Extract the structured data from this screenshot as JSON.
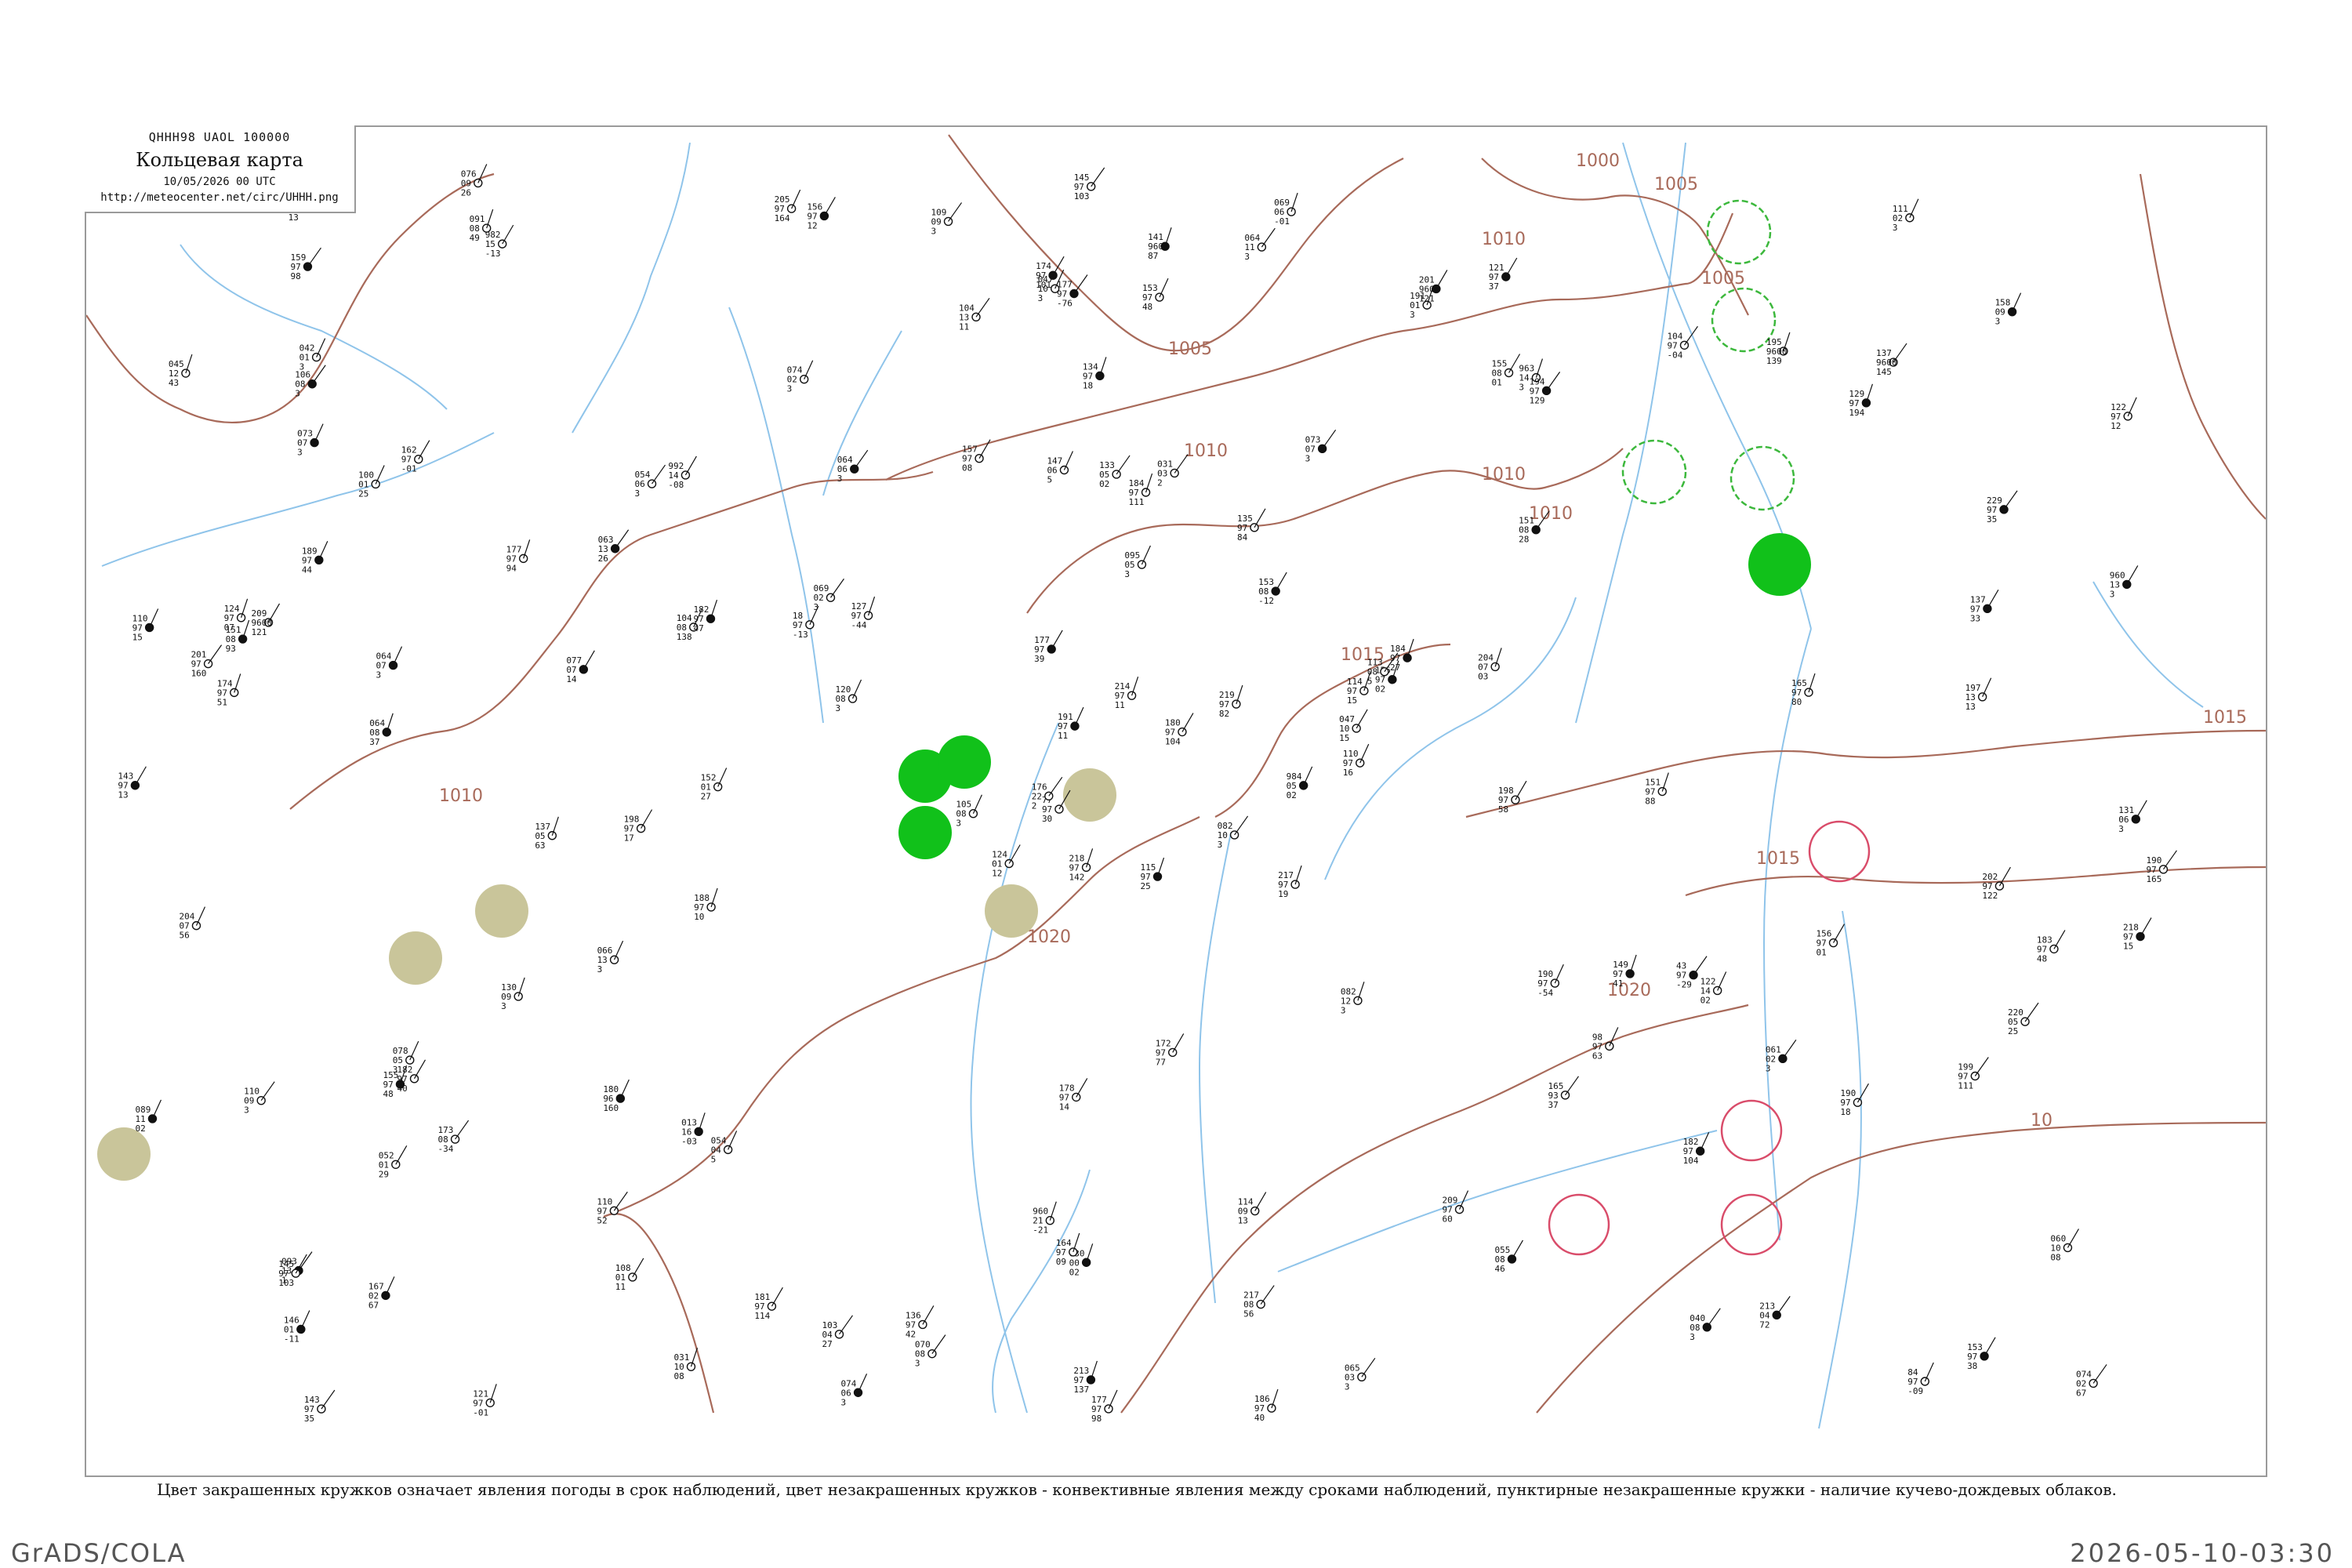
{
  "header": {
    "code_line": "QHHH98  UAOL  100000",
    "title": "Кольцевая карта",
    "date": "10/05/2026 00 UTC",
    "url": "http://meteocenter.net/circ/UHHH.png"
  },
  "caption": "Цвет закрашенных кружков означает явления погоды в срок наблюдений, цвет незакрашенных кружков - конвективные явления между сроками наблюдений, пунктирные незакрашенные кружки - наличие кучево-дождевых облаков.",
  "footer": {
    "left": "GrADS/COLA",
    "right": "2026-05-10-03:30"
  },
  "colors": {
    "isobar": "#a86a5a",
    "river": "#8fc4ea",
    "fill_green": "#11c11a",
    "fill_olive": "#c9c59a",
    "ring_green": "#3cb83c",
    "ring_red": "#d94c6a",
    "station": "#111111"
  },
  "isobar_labels": [
    "1000",
    "1005",
    "1005",
    "1005",
    "1010",
    "1010",
    "1010",
    "1010",
    "1010",
    "1015",
    "1015",
    "1015",
    "1020",
    "1020",
    "10"
  ],
  "stations": [
    {
      "t": "115",
      "d": "97",
      "p": "25"
    },
    {
      "t": "100",
      "d": "01",
      "p": "25"
    },
    {
      "t": "77",
      "d": "97",
      "p": "30"
    },
    {
      "t": "093",
      "d": "13",
      "p": "1"
    },
    {
      "t": "114",
      "d": "97",
      "p": "15"
    },
    {
      "t": "054",
      "d": "04",
      "p": "5"
    },
    {
      "t": "121",
      "d": "97",
      "p": "37"
    },
    {
      "t": "031",
      "d": "03",
      "p": "2"
    },
    {
      "t": "963",
      "d": "14",
      "p": "3"
    },
    {
      "t": "984",
      "d": "05",
      "p": "02"
    },
    {
      "t": "982",
      "d": "15",
      "p": "-13"
    },
    {
      "t": "074",
      "d": "02",
      "p": "67"
    },
    {
      "t": "064",
      "d": "08",
      "p": "37"
    },
    {
      "t": "122",
      "d": "97",
      "p": "12"
    },
    {
      "t": "124",
      "d": "01",
      "p": "12"
    },
    {
      "t": "151",
      "d": "08",
      "p": "28"
    },
    {
      "t": "121",
      "d": "97",
      "p": "-01"
    },
    {
      "t": "147",
      "d": "06",
      "p": "5"
    },
    {
      "t": "153",
      "d": "08",
      "p": "-12"
    },
    {
      "t": "173",
      "d": "08",
      "p": "-34"
    },
    {
      "t": "127",
      "d": "97",
      "p": "-44"
    },
    {
      "t": "146",
      "d": "01",
      "p": "-11"
    },
    {
      "t": "108",
      "d": "01",
      "p": "11"
    },
    {
      "t": "133",
      "d": "05",
      "p": "02"
    },
    {
      "t": "156",
      "d": "97",
      "p": "02"
    },
    {
      "t": "122",
      "d": "14",
      "p": "02"
    },
    {
      "t": "162",
      "d": "97",
      "p": "-01"
    },
    {
      "t": "177",
      "d": "97",
      "p": "-76"
    },
    {
      "t": "174",
      "d": "97",
      "p": "51"
    },
    {
      "t": "190",
      "d": "97",
      "p": "-54"
    },
    {
      "t": "960",
      "d": "13",
      "p": "3"
    },
    {
      "t": "176",
      "d": "22",
      "p": "2"
    },
    {
      "t": "960",
      "d": "21",
      "p": "-21"
    },
    {
      "t": "191",
      "d": "97",
      "p": "11"
    },
    {
      "t": "992",
      "d": "14",
      "p": "-08"
    },
    {
      "t": "104",
      "d": "97",
      "p": "-04"
    },
    {
      "t": "013",
      "d": "16",
      "p": "-03"
    },
    {
      "t": "84",
      "d": "97",
      "p": "-09"
    },
    {
      "t": "060",
      "d": "10",
      "p": "08"
    },
    {
      "t": "43",
      "d": "97",
      "p": "-29"
    },
    {
      "t": "069",
      "d": "06",
      "p": "-01"
    },
    {
      "t": "18",
      "d": "97",
      "p": "-13"
    },
    {
      "t": "077",
      "d": "07",
      "p": "14"
    },
    {
      "t": "165",
      "d": "93",
      "p": "37"
    },
    {
      "t": "031",
      "d": "10",
      "p": "08"
    },
    {
      "t": "110",
      "d": "97",
      "p": "15"
    },
    {
      "t": "047",
      "d": "10",
      "p": "15"
    },
    {
      "t": "143",
      "d": "97",
      "p": "35"
    },
    {
      "t": "030",
      "d": "00",
      "p": "02"
    },
    {
      "t": "110",
      "d": "97",
      "p": "16"
    },
    {
      "t": "052",
      "d": "01",
      "p": "29"
    },
    {
      "t": "229",
      "d": "97",
      "p": "35"
    },
    {
      "t": "045",
      "d": "12",
      "p": "43"
    },
    {
      "t": "98",
      "d": "97",
      "p": "63"
    },
    {
      "t": "055",
      "d": "08",
      "p": "46"
    },
    {
      "t": "110",
      "d": "97",
      "p": "52"
    },
    {
      "t": "091",
      "d": "08",
      "p": "49"
    },
    {
      "t": "116",
      "d": "97",
      "p": "13"
    },
    {
      "t": "114",
      "d": "09",
      "p": "13"
    },
    {
      "t": "137",
      "d": "9600",
      "p": "145"
    },
    {
      "t": "141",
      "d": "9600",
      "p": "87"
    },
    {
      "t": "152",
      "d": "01",
      "p": "27"
    },
    {
      "t": "209",
      "d": "9600",
      "p": "121"
    },
    {
      "t": "063",
      "d": "13",
      "p": "26"
    },
    {
      "t": "195",
      "d": "9600",
      "p": "139"
    },
    {
      "t": "076",
      "d": "09",
      "p": "26"
    },
    {
      "t": "201",
      "d": "9600",
      "p": "121"
    },
    {
      "t": "104",
      "d": "13",
      "p": "11"
    },
    {
      "t": "214",
      "d": "97",
      "p": "11"
    },
    {
      "t": "089",
      "d": "11",
      "p": "02"
    },
    {
      "t": "178",
      "d": "97",
      "p": "14"
    },
    {
      "t": "103",
      "d": "04",
      "p": "27"
    },
    {
      "t": "149",
      "d": "97",
      "p": "41"
    },
    {
      "t": "104",
      "d": "08",
      "p": "138"
    },
    {
      "t": "145",
      "d": "97",
      "p": "103"
    },
    {
      "t": "159",
      "d": "97",
      "p": "98"
    },
    {
      "t": "177",
      "d": "97",
      "p": "94"
    },
    {
      "t": "204",
      "d": "07",
      "p": "56"
    },
    {
      "t": "177",
      "d": "97",
      "p": "39"
    },
    {
      "t": "217",
      "d": "08",
      "p": "56"
    },
    {
      "t": "219",
      "d": "97",
      "p": "82"
    },
    {
      "t": "167",
      "d": "02",
      "p": "67"
    },
    {
      "t": "198",
      "d": "97",
      "p": "58"
    },
    {
      "t": "220",
      "d": "05",
      "p": "25"
    },
    {
      "t": "213",
      "d": "97",
      "p": "137"
    },
    {
      "t": "197",
      "d": "13",
      "p": "13"
    },
    {
      "t": "172",
      "d": "97",
      "p": "77"
    },
    {
      "t": "213",
      "d": "04",
      "p": "72"
    },
    {
      "t": "186",
      "d": "97",
      "p": "40"
    },
    {
      "t": "209",
      "d": "97",
      "p": "60"
    },
    {
      "t": "174",
      "d": "97",
      "p": "101"
    },
    {
      "t": "190",
      "d": "97",
      "p": "165"
    },
    {
      "t": "204",
      "d": "07",
      "p": "03"
    },
    {
      "t": "182",
      "d": "97",
      "p": "104"
    },
    {
      "t": "180",
      "d": "97",
      "p": "104"
    },
    {
      "t": "199",
      "d": "97",
      "p": "111"
    },
    {
      "t": "151",
      "d": "08",
      "p": "93"
    },
    {
      "t": "177",
      "d": "97",
      "p": "98"
    },
    {
      "t": "155",
      "d": "08",
      "p": "01"
    },
    {
      "t": "194",
      "d": "97",
      "p": "129"
    },
    {
      "t": "137",
      "d": "05",
      "p": "63"
    },
    {
      "t": "205",
      "d": "97",
      "p": "164"
    },
    {
      "t": "131",
      "d": "06",
      "p": "3"
    },
    {
      "t": "201",
      "d": "97",
      "p": "160"
    },
    {
      "t": "130",
      "d": "09",
      "p": "3"
    },
    {
      "t": "180",
      "d": "96",
      "p": "160"
    },
    {
      "t": "181",
      "d": "97",
      "p": "114"
    },
    {
      "t": "113",
      "d": "08",
      "p": "5"
    },
    {
      "t": "129",
      "d": "97",
      "p": "194"
    },
    {
      "t": "120",
      "d": "08",
      "p": "3"
    },
    {
      "t": "202",
      "d": "97",
      "p": "122"
    },
    {
      "t": "106",
      "d": "08",
      "p": "3"
    },
    {
      "t": "184",
      "d": "97",
      "p": "111"
    },
    {
      "t": "105",
      "d": "08",
      "p": "3"
    },
    {
      "t": "156",
      "d": "97",
      "p": "12"
    },
    {
      "t": "110",
      "d": "09",
      "p": "3"
    },
    {
      "t": "218",
      "d": "97",
      "p": "142"
    },
    {
      "t": "158",
      "d": "09",
      "p": "3"
    },
    {
      "t": "157",
      "d": "97",
      "p": "08"
    },
    {
      "t": "109",
      "d": "09",
      "p": "3"
    },
    {
      "t": "155",
      "d": "97",
      "p": "48"
    },
    {
      "t": "111",
      "d": "02",
      "p": "3"
    },
    {
      "t": "135",
      "d": "97",
      "p": "84"
    },
    {
      "t": "064",
      "d": "06",
      "p": "3"
    },
    {
      "t": "151",
      "d": "97",
      "p": "88"
    },
    {
      "t": "066",
      "d": "13",
      "p": "3"
    },
    {
      "t": "153",
      "d": "97",
      "p": "38"
    },
    {
      "t": "070",
      "d": "08",
      "p": "3"
    },
    {
      "t": "165",
      "d": "97",
      "p": "80"
    },
    {
      "t": "073",
      "d": "07",
      "p": "3"
    },
    {
      "t": "182",
      "d": "97",
      "p": "40"
    },
    {
      "t": "065",
      "d": "03",
      "p": "3"
    },
    {
      "t": "182",
      "d": "97",
      "p": "47"
    },
    {
      "t": "074",
      "d": "02",
      "p": "3"
    },
    {
      "t": "183",
      "d": "97",
      "p": "48"
    },
    {
      "t": "061",
      "d": "02",
      "p": "3"
    },
    {
      "t": "188",
      "d": "97",
      "p": "10"
    },
    {
      "t": "078",
      "d": "05",
      "p": "3"
    },
    {
      "t": "218",
      "d": "97",
      "p": "15"
    },
    {
      "t": "069",
      "d": "02",
      "p": "3"
    },
    {
      "t": "217",
      "d": "97",
      "p": "19"
    },
    {
      "t": "064",
      "d": "07",
      "p": "3"
    },
    {
      "t": "190",
      "d": "97",
      "p": "18"
    },
    {
      "t": "082",
      "d": "10",
      "p": "3"
    },
    {
      "t": "184",
      "d": "97",
      "p": "27"
    },
    {
      "t": "042",
      "d": "01",
      "p": "3"
    },
    {
      "t": "136",
      "d": "97",
      "p": "42"
    },
    {
      "t": "040",
      "d": "08",
      "p": "3"
    },
    {
      "t": "164",
      "d": "97",
      "p": "09"
    },
    {
      "t": "047",
      "d": "10",
      "p": "3"
    },
    {
      "t": "137",
      "d": "97",
      "p": "33"
    },
    {
      "t": "054",
      "d": "06",
      "p": "3"
    },
    {
      "t": "124",
      "d": "97",
      "p": "07"
    },
    {
      "t": "074",
      "d": "06",
      "p": "3"
    },
    {
      "t": "156",
      "d": "97",
      "p": "01"
    },
    {
      "t": "064",
      "d": "11",
      "p": "3"
    },
    {
      "t": "134",
      "d": "97",
      "p": "18"
    },
    {
      "t": "095",
      "d": "05",
      "p": "3"
    },
    {
      "t": "198",
      "d": "97",
      "p": "17"
    },
    {
      "t": "073",
      "d": "07",
      "p": "3"
    },
    {
      "t": "082",
      "d": "12",
      "p": "3"
    },
    {
      "t": "153",
      "d": "97",
      "p": "48"
    },
    {
      "t": "143",
      "d": "97",
      "p": "13"
    },
    {
      "t": "145",
      "d": "97",
      "p": "103"
    },
    {
      "t": "191",
      "d": "01",
      "p": "3"
    },
    {
      "t": "189",
      "d": "97",
      "p": "44"
    }
  ]
}
